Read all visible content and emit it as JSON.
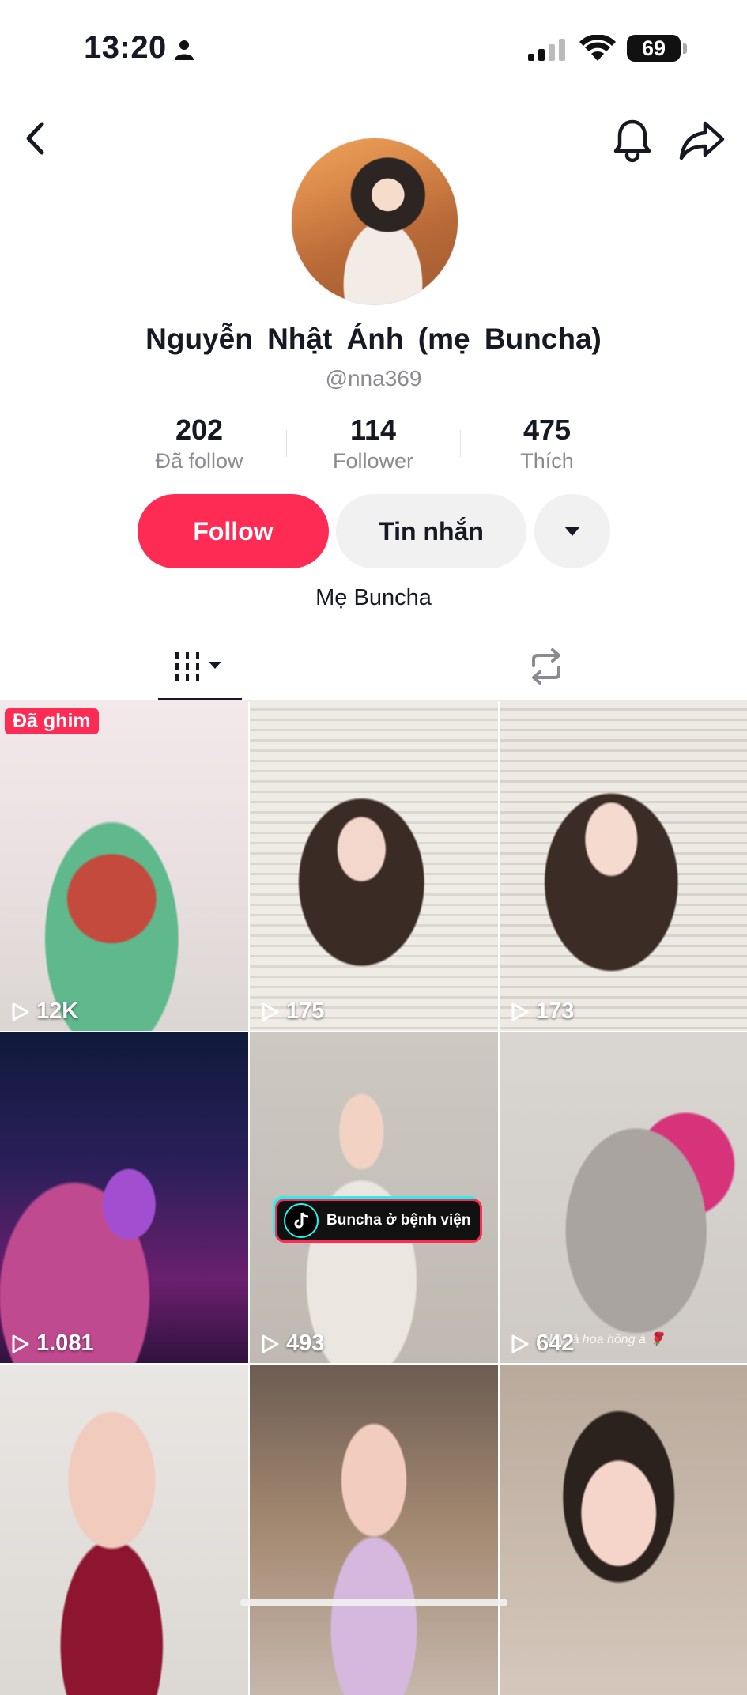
{
  "status_bar": {
    "time": "13:20",
    "battery": "69"
  },
  "profile": {
    "name": "Nguyễn Nhật Ánh (mẹ Buncha)",
    "handle": "@nna369",
    "bio": "Mẹ Buncha",
    "stats": [
      {
        "value": "202",
        "label": "Đã follow"
      },
      {
        "value": "114",
        "label": "Follower"
      },
      {
        "value": "475",
        "label": "Thích"
      }
    ]
  },
  "actions": {
    "follow": "Follow",
    "message": "Tin nhắn"
  },
  "tabs": {
    "videos_icon": "grid-icon",
    "reposts_icon": "repost-icon"
  },
  "videos": [
    {
      "views": "12K",
      "pinned": "Đã ghim"
    },
    {
      "views": "175"
    },
    {
      "views": "173"
    },
    {
      "views": "1.081"
    },
    {
      "views": "493",
      "sticker": "Buncha ở bệnh viện"
    },
    {
      "views": "642",
      "caption": "Này là hoa hồng à 🌹"
    },
    {
      "views": ""
    },
    {
      "views": ""
    },
    {
      "views": ""
    }
  ],
  "colors": {
    "accent": "#fe2c55",
    "text": "#161823",
    "muted": "#8a8b91"
  }
}
